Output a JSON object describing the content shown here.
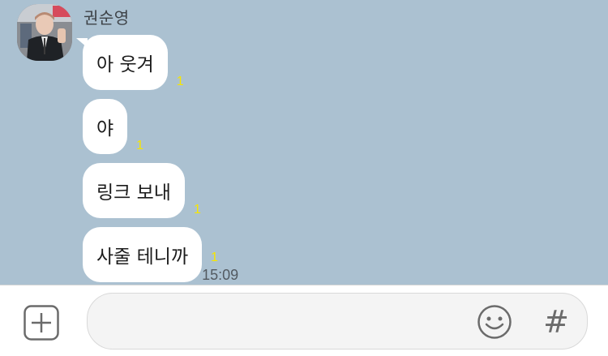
{
  "chat": {
    "sender_name": "권순영",
    "messages": [
      {
        "text": "아 웃겨",
        "unread": "1",
        "time": ""
      },
      {
        "text": "야",
        "unread": "1",
        "time": ""
      },
      {
        "text": "링크 보내",
        "unread": "1",
        "time": ""
      },
      {
        "text": "사줄 테니까",
        "unread": "1",
        "time": "15:09"
      }
    ]
  },
  "input_bar": {
    "placeholder": "",
    "hash_symbol": "#",
    "icons": [
      "plus-icon",
      "emoji-icon",
      "hashtag-icon"
    ]
  },
  "colors": {
    "chat_background": "#abc1d1",
    "bubble": "#ffffff",
    "unread_count": "#f7e600",
    "timestamp": "#535a61"
  }
}
